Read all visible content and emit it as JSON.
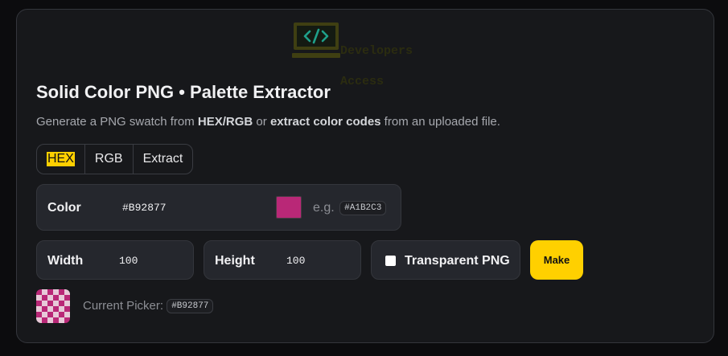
{
  "logo": {
    "line1": "Developers",
    "line2": "Access",
    "symbol": "</>"
  },
  "title": "Solid Color PNG • Palette Extractor",
  "subtitle": {
    "p1": "Generate a PNG swatch from ",
    "b1": "HEX/RGB",
    "p2": " or ",
    "b2": "extract color codes",
    "p3": " from an uploaded file."
  },
  "tabs": [
    {
      "label": "HEX",
      "active": true
    },
    {
      "label": "RGB",
      "active": false
    },
    {
      "label": "Extract",
      "active": false
    }
  ],
  "color_field": {
    "label": "Color",
    "value": "#B92877",
    "example_prefix": "e.g.",
    "example_code": "#A1B2C3",
    "swatch_color": "#b92877"
  },
  "width_field": {
    "label": "Width",
    "value": "100"
  },
  "height_field": {
    "label": "Height",
    "value": "100"
  },
  "transparent": {
    "label": "Transparent PNG",
    "checked": false
  },
  "make_button": "Make",
  "current_picker": {
    "label": "Current Picker:",
    "code": "#B92877"
  },
  "colors": {
    "accent": "#ffd000",
    "picker": "#b92877",
    "checker_light": "#e7c9d8"
  }
}
